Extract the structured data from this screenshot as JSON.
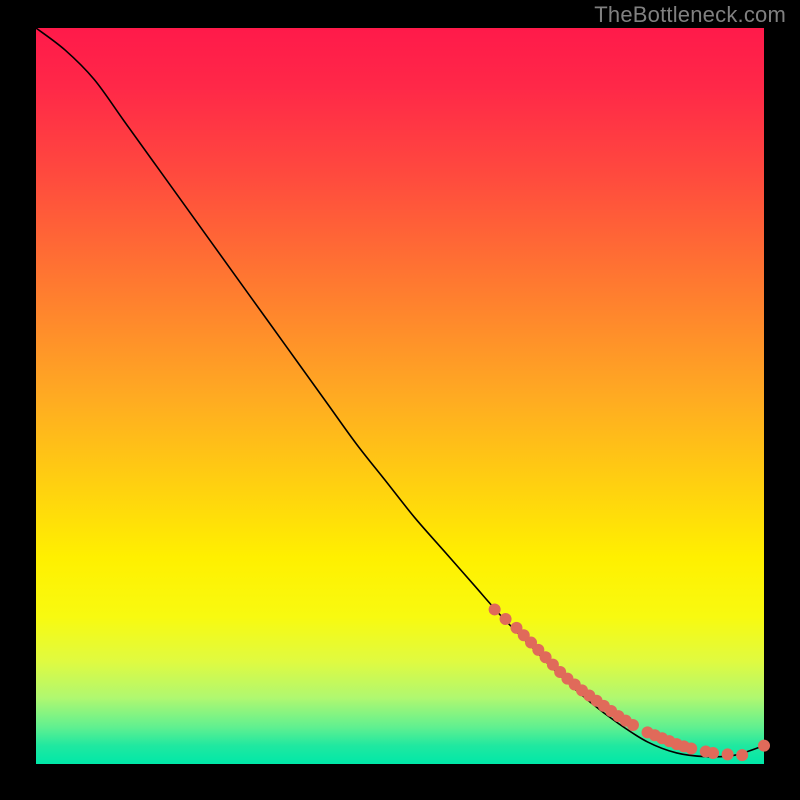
{
  "watermark": "TheBottleneck.com",
  "chart_data": {
    "type": "line",
    "title": "",
    "xlabel": "",
    "ylabel": "",
    "xlim": [
      0,
      100
    ],
    "ylim": [
      0,
      100
    ],
    "gradient": {
      "stops": [
        {
          "offset": 0.0,
          "color": "#ff1a4a"
        },
        {
          "offset": 0.08,
          "color": "#ff2848"
        },
        {
          "offset": 0.2,
          "color": "#ff4a3e"
        },
        {
          "offset": 0.35,
          "color": "#ff7a30"
        },
        {
          "offset": 0.5,
          "color": "#ffaa22"
        },
        {
          "offset": 0.62,
          "color": "#ffd010"
        },
        {
          "offset": 0.72,
          "color": "#fff000"
        },
        {
          "offset": 0.8,
          "color": "#f8fa10"
        },
        {
          "offset": 0.86,
          "color": "#e0fa40"
        },
        {
          "offset": 0.91,
          "color": "#b0f870"
        },
        {
          "offset": 0.95,
          "color": "#60f090"
        },
        {
          "offset": 0.975,
          "color": "#20e8a0"
        },
        {
          "offset": 1.0,
          "color": "#00e8a8"
        }
      ]
    },
    "series": [
      {
        "name": "curve",
        "type": "line",
        "x": [
          0,
          4,
          8,
          12,
          16,
          20,
          24,
          28,
          32,
          36,
          40,
          44,
          48,
          52,
          56,
          60,
          64,
          68,
          72,
          76,
          80,
          84,
          88,
          92,
          96,
          100
        ],
        "y": [
          100,
          97,
          93,
          87.5,
          82,
          76.5,
          71,
          65.5,
          60,
          54.5,
          49,
          43.5,
          38.5,
          33.5,
          29,
          24.5,
          20,
          16,
          12,
          8.5,
          5.5,
          3,
          1.5,
          1,
          1.2,
          2.5
        ]
      },
      {
        "name": "markers",
        "type": "scatter",
        "color": "#e06a5a",
        "x": [
          63,
          64.5,
          66,
          67,
          68,
          69,
          70,
          71,
          72,
          73,
          74,
          75,
          76,
          77,
          78,
          79,
          80,
          81,
          82,
          84,
          85,
          86,
          87,
          88,
          89,
          90,
          92,
          93,
          95,
          97,
          100
        ],
        "y": [
          21,
          19.7,
          18.5,
          17.5,
          16.5,
          15.5,
          14.5,
          13.5,
          12.5,
          11.6,
          10.8,
          10,
          9.3,
          8.6,
          7.9,
          7.2,
          6.5,
          5.9,
          5.3,
          4.3,
          3.9,
          3.5,
          3.1,
          2.7,
          2.4,
          2.1,
          1.7,
          1.5,
          1.3,
          1.2,
          2.5
        ]
      }
    ]
  }
}
